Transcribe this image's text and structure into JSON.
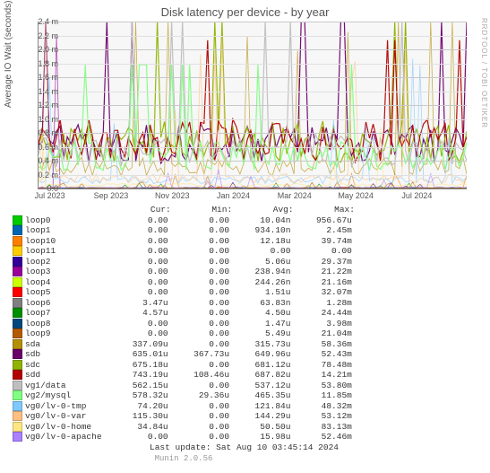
{
  "title": "Disk latency per device - by year",
  "ylabel": "Average IO Wait (seconds)",
  "sidetext": "RRDTOOL / TOBI OETIKER",
  "footer": "Munin 2.0.56",
  "last_update": "Last update: Sat Aug 10 03:45:14 2024",
  "columns": {
    "cur": "Cur:",
    "min": "Min:",
    "avg": "Avg:",
    "max": "Max:"
  },
  "chart_data": {
    "type": "line",
    "xlabel": "",
    "ylabel": "Average IO Wait (seconds)",
    "x_categories": [
      "Jul 2023",
      "Sep 2023",
      "Nov 2023",
      "Jan 2024",
      "Mar 2024",
      "May 2024",
      "Jul 2024"
    ],
    "ylim": [
      0,
      0.0024
    ],
    "yticks": [
      "0.0",
      "0.2 m",
      "0.4 m",
      "0.6 m",
      "0.8 m",
      "1.0 m",
      "1.2 m",
      "1.4 m",
      "1.6 m",
      "1.8 m",
      "2.0 m",
      "2.2 m",
      "2.4 m"
    ],
    "series": [
      {
        "name": "loop0",
        "color": "#00cc00",
        "cur": "0.00",
        "min": "0.00",
        "avg": "10.04n",
        "max": "956.67u"
      },
      {
        "name": "loop1",
        "color": "#0066b3",
        "cur": "0.00",
        "min": "0.00",
        "avg": "934.10n",
        "max": "2.45m"
      },
      {
        "name": "loop10",
        "color": "#ff8000",
        "cur": "0.00",
        "min": "0.00",
        "avg": "12.18u",
        "max": "39.74m"
      },
      {
        "name": "loop11",
        "color": "#ffcc00",
        "cur": "0.00",
        "min": "0.00",
        "avg": "0.00",
        "max": "0.00"
      },
      {
        "name": "loop2",
        "color": "#330099",
        "cur": "0.00",
        "min": "0.00",
        "avg": "5.06u",
        "max": "29.37m"
      },
      {
        "name": "loop3",
        "color": "#990099",
        "cur": "0.00",
        "min": "0.00",
        "avg": "238.94n",
        "max": "21.22m"
      },
      {
        "name": "loop4",
        "color": "#ccff00",
        "cur": "0.00",
        "min": "0.00",
        "avg": "244.26n",
        "max": "21.16m"
      },
      {
        "name": "loop5",
        "color": "#ff0000",
        "cur": "0.00",
        "min": "0.00",
        "avg": "1.51u",
        "max": "32.07m"
      },
      {
        "name": "loop6",
        "color": "#808080",
        "cur": "3.47u",
        "min": "0.00",
        "avg": "63.83n",
        "max": "1.28m"
      },
      {
        "name": "loop7",
        "color": "#008f00",
        "cur": "4.57u",
        "min": "0.00",
        "avg": "4.50u",
        "max": "24.44m"
      },
      {
        "name": "loop8",
        "color": "#00487d",
        "cur": "0.00",
        "min": "0.00",
        "avg": "1.47u",
        "max": "3.98m"
      },
      {
        "name": "loop9",
        "color": "#b35a00",
        "cur": "0.00",
        "min": "0.00",
        "avg": "5.49u",
        "max": "21.04m"
      },
      {
        "name": "sda",
        "color": "#b38f00",
        "cur": "337.09u",
        "min": "0.00",
        "avg": "315.73u",
        "max": "58.36m"
      },
      {
        "name": "sdb",
        "color": "#6b006b",
        "cur": "635.01u",
        "min": "367.73u",
        "avg": "649.96u",
        "max": "52.43m"
      },
      {
        "name": "sdc",
        "color": "#8fb300",
        "cur": "675.18u",
        "min": "0.00",
        "avg": "681.12u",
        "max": "78.48m"
      },
      {
        "name": "sdd",
        "color": "#b30000",
        "cur": "743.19u",
        "min": "108.46u",
        "avg": "687.82u",
        "max": "14.21m"
      },
      {
        "name": "vg1/data",
        "color": "#bebebe",
        "cur": "562.15u",
        "min": "0.00",
        "avg": "537.12u",
        "max": "53.80m"
      },
      {
        "name": "vg2/mysql",
        "color": "#80ff80",
        "cur": "578.32u",
        "min": "29.36u",
        "avg": "465.35u",
        "max": "11.85m"
      },
      {
        "name": "vg0/lv-0-tmp",
        "color": "#80c9ff",
        "cur": "74.20u",
        "min": "0.00",
        "avg": "121.84u",
        "max": "48.32m"
      },
      {
        "name": "vg0/lv-0-var",
        "color": "#ffc080",
        "cur": "115.30u",
        "min": "0.00",
        "avg": "144.29u",
        "max": "53.12m"
      },
      {
        "name": "vg0/lv-0-home",
        "color": "#ffe680",
        "cur": "34.84u",
        "min": "0.00",
        "avg": "50.50u",
        "max": "83.13m"
      },
      {
        "name": "vg0/lv-0-apache",
        "color": "#aa80ff",
        "cur": "0.00",
        "min": "0.00",
        "avg": "15.98u",
        "max": "52.46m"
      }
    ]
  }
}
